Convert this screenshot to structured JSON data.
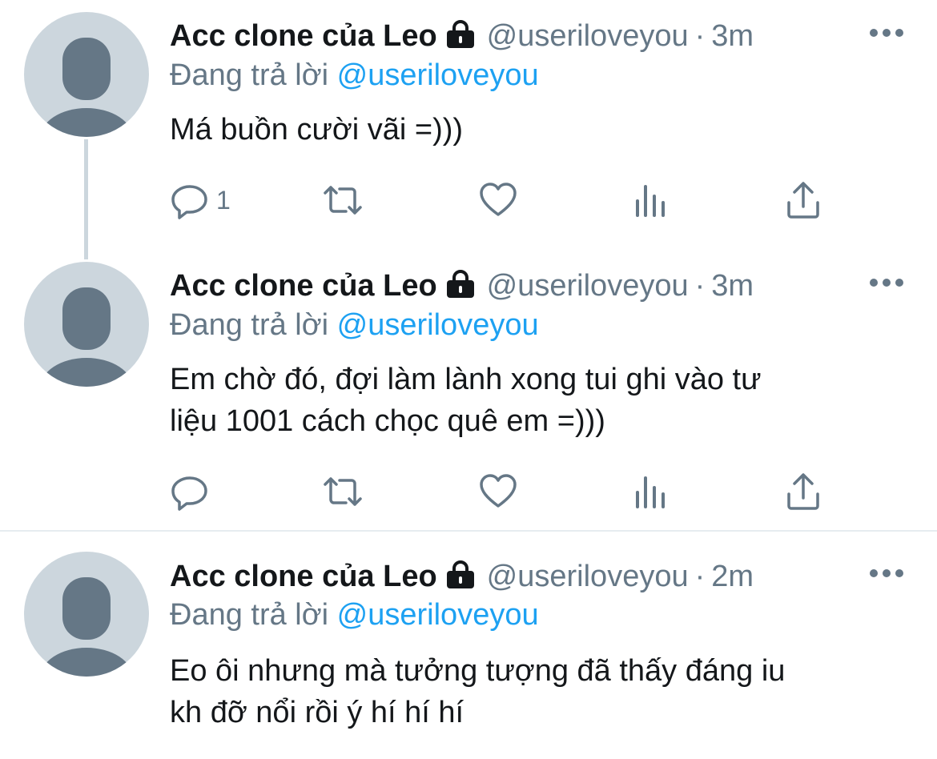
{
  "tweets": [
    {
      "name": "Acc clone của Leo",
      "handle": "@useriloveyou",
      "separator": "·",
      "time": "3m",
      "reply_prefix": "Đang trả lời",
      "reply_mention": "@useriloveyou",
      "text_lines": [
        "Má buồn cười vãi =)))"
      ],
      "reply_count": "1"
    },
    {
      "name": "Acc clone của Leo",
      "handle": "@useriloveyou",
      "separator": "·",
      "time": "3m",
      "reply_prefix": "Đang trả lời",
      "reply_mention": "@useriloveyou",
      "text_lines": [
        "Em chờ đó, đợi làm lành xong tui ghi vào tư",
        "liệu 1001 cách chọc quê em =)))"
      ],
      "reply_count": ""
    },
    {
      "name": "Acc clone của Leo",
      "handle": "@useriloveyou",
      "separator": "·",
      "time": "2m",
      "reply_prefix": "Đang trả lời",
      "reply_mention": "@useriloveyou",
      "text_lines": [
        "Eo ôi nhưng mà tưởng tượng đã thấy đáng iu",
        "kh đỡ nổi rồi ý hí hí hí"
      ],
      "reply_count": ""
    }
  ],
  "icons": {
    "avatar": "default-avatar-icon",
    "lock": "lock-icon",
    "more": "more-icon",
    "reply": "reply-icon",
    "retweet": "retweet-icon",
    "like": "like-icon",
    "analytics": "analytics-icon",
    "share": "share-icon"
  },
  "colors": {
    "text": "#14171a",
    "secondary": "#657786",
    "mention": "#1da1f2",
    "avatar_bg": "#ccd6dd",
    "avatar_fg": "#657786",
    "divider": "#e6ecf0"
  }
}
